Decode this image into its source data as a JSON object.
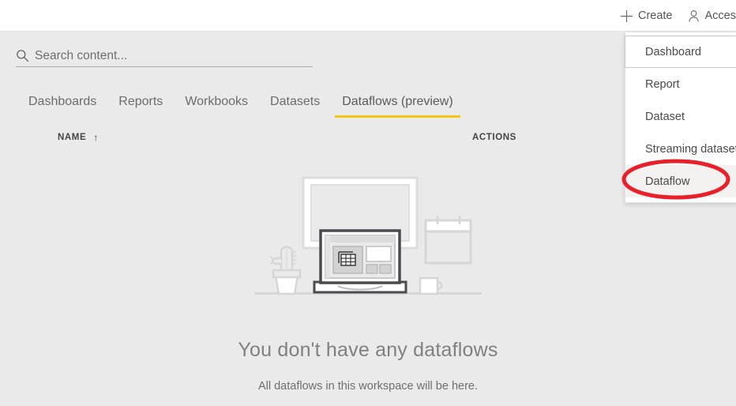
{
  "header": {
    "actions": [
      {
        "icon": "plus-icon",
        "label": "Create"
      },
      {
        "icon": "person-icon",
        "label": "Acces"
      }
    ]
  },
  "search": {
    "icon": "search-icon",
    "placeholder": "Search content...",
    "value": ""
  },
  "tabs": [
    {
      "label": "Dashboards",
      "active": false
    },
    {
      "label": "Reports",
      "active": false
    },
    {
      "label": "Workbooks",
      "active": false
    },
    {
      "label": "Datasets",
      "active": false
    },
    {
      "label": "Dataflows (preview)",
      "active": true
    }
  ],
  "columns": {
    "name_label": "NAME",
    "name_sort_icon": "sort-ascending-arrow",
    "actions_label": "ACTIONS"
  },
  "empty_state": {
    "illustration": "desk-with-laptop-dashboard-illustration",
    "title": "You don't have any dataflows",
    "subtitle": "All dataflows in this workspace will be here."
  },
  "create_menu": {
    "items": [
      {
        "label": "Dashboard",
        "state": "focused"
      },
      {
        "label": "Report",
        "state": "normal"
      },
      {
        "label": "Dataset",
        "state": "normal"
      },
      {
        "label": "Streaming dataset",
        "state": "normal"
      },
      {
        "label": "Dataflow",
        "state": "hovered"
      }
    ]
  },
  "annotation": {
    "shape": "red-ellipse-highlight",
    "target": "Dataflow",
    "color": "#e8202a"
  },
  "colors": {
    "accent_yellow": "#f2c811",
    "page_background": "#eaeaea",
    "header_background": "#ffffff",
    "annotation_red": "#e8202a"
  }
}
